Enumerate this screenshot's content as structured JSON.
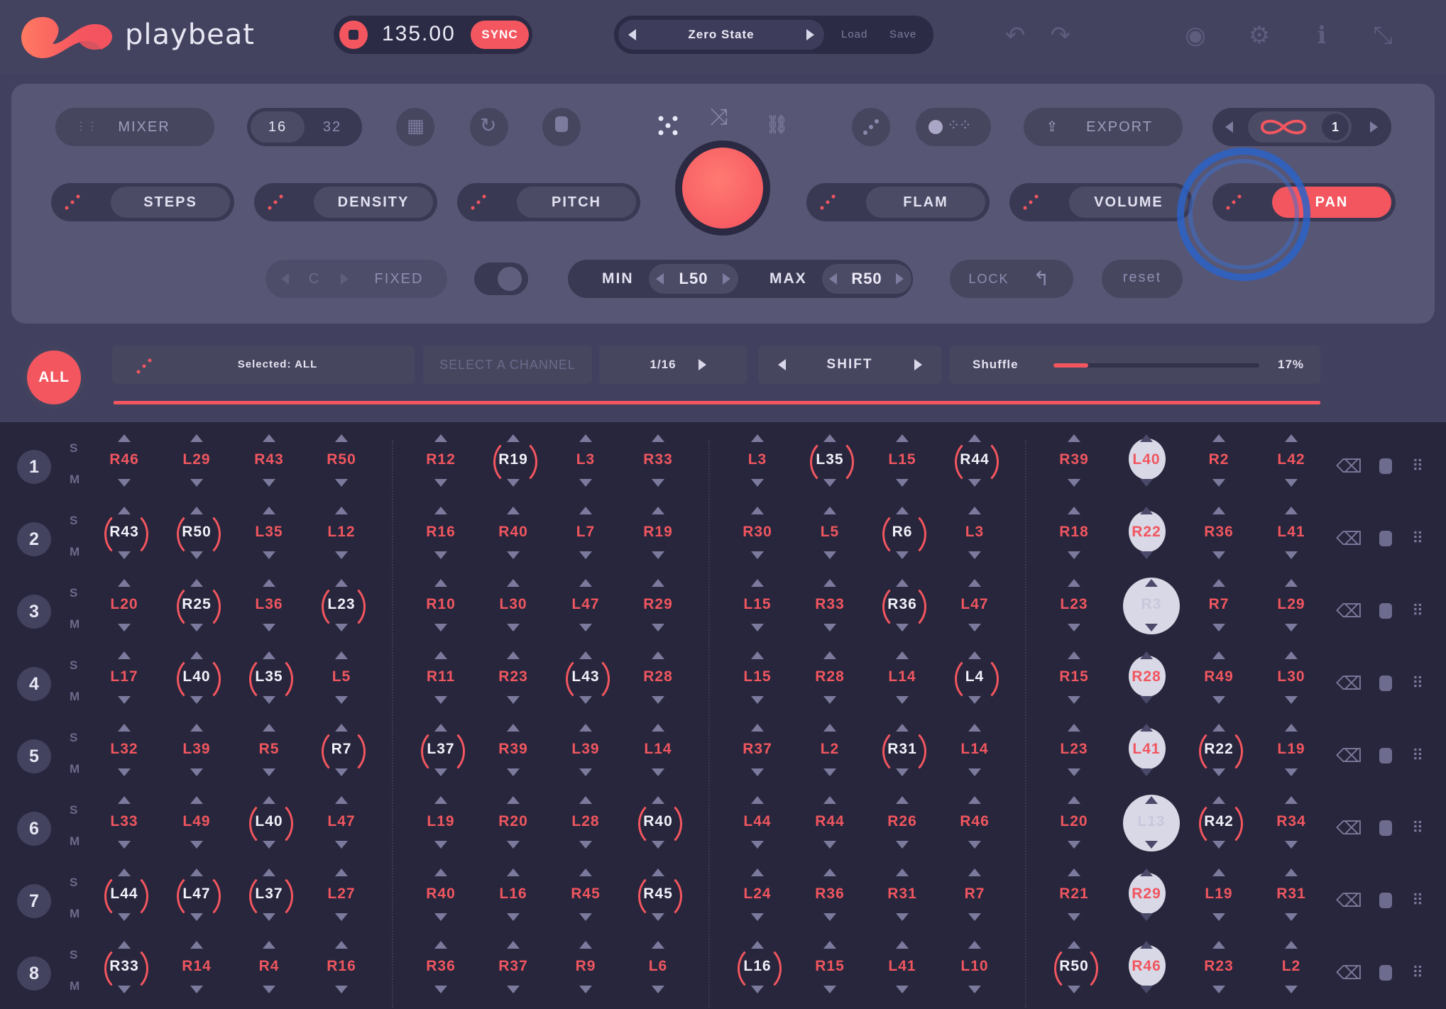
{
  "app": {
    "name": "playbeat"
  },
  "transport": {
    "bpm": "135.00",
    "sync_label": "SYNC"
  },
  "preset": {
    "name": "Zero State",
    "load_label": "Load",
    "save_label": "Save"
  },
  "header_icons": [
    "undo-icon",
    "redo-icon",
    "palette-icon",
    "gear-icon",
    "info-icon",
    "collapse-icon"
  ],
  "panel": {
    "mixer_label": "MIXER",
    "steps_options": [
      "16",
      "32"
    ],
    "export_label": "EXPORT",
    "pattern_number": "1",
    "params": [
      "STEPS",
      "DENSITY",
      "PITCH",
      "FLAM",
      "VOLUME",
      "PAN"
    ],
    "active_param": "PAN",
    "key_value": "C",
    "key_mode": "FIXED",
    "min_label": "MIN",
    "min_value": "L50",
    "max_label": "MAX",
    "max_value": "R50",
    "lock_label": "LOCK",
    "reset_label": "reset"
  },
  "selection": {
    "all_label": "ALL",
    "selected_text": "Selected: ALL",
    "select_channel_placeholder": "SELECT A CHANNEL",
    "resolution": "1/16",
    "shift_label": "SHIFT",
    "shuffle_label": "Shuffle",
    "shuffle_value": "17%",
    "shuffle_fraction": 0.17
  },
  "channels": [
    {
      "num": "1",
      "s": "S",
      "m": "M",
      "steps": [
        "R46",
        "L29",
        "R43",
        "R50",
        "R12",
        "R19",
        "L3",
        "R33",
        "L3",
        "L35",
        "L15",
        "R44",
        "R39",
        "L40",
        "R2",
        "L42"
      ]
    },
    {
      "num": "2",
      "s": "S",
      "m": "M",
      "steps": [
        "R43",
        "R50",
        "L35",
        "L12",
        "R16",
        "R40",
        "L7",
        "R19",
        "R30",
        "L5",
        "R6",
        "L3",
        "R18",
        "R22",
        "R36",
        "L41"
      ]
    },
    {
      "num": "3",
      "s": "S",
      "m": "M",
      "steps": [
        "L20",
        "R25",
        "L36",
        "L23",
        "R10",
        "L30",
        "L47",
        "R29",
        "L15",
        "R33",
        "R36",
        "L47",
        "L23",
        "R3",
        "R7",
        "L29"
      ]
    },
    {
      "num": "4",
      "s": "S",
      "m": "M",
      "steps": [
        "L17",
        "L40",
        "L35",
        "L5",
        "R11",
        "R23",
        "L43",
        "R28",
        "L15",
        "R28",
        "L14",
        "L4",
        "R15",
        "R28",
        "R49",
        "L30"
      ]
    },
    {
      "num": "5",
      "s": "S",
      "m": "M",
      "steps": [
        "L32",
        "L39",
        "R5",
        "R7",
        "L37",
        "R39",
        "L39",
        "L14",
        "R37",
        "L2",
        "R31",
        "L14",
        "L23",
        "L41",
        "R22",
        "L19"
      ]
    },
    {
      "num": "6",
      "s": "S",
      "m": "M",
      "steps": [
        "L33",
        "L49",
        "L40",
        "L47",
        "L19",
        "R20",
        "L28",
        "R40",
        "L44",
        "R44",
        "R26",
        "R46",
        "L20",
        "L13",
        "R42",
        "R34"
      ]
    },
    {
      "num": "7",
      "s": "S",
      "m": "M",
      "steps": [
        "L44",
        "L47",
        "L37",
        "L27",
        "R40",
        "L16",
        "R45",
        "R45",
        "L24",
        "R36",
        "R31",
        "R7",
        "R21",
        "R29",
        "L19",
        "R31"
      ]
    },
    {
      "num": "8",
      "s": "S",
      "m": "M",
      "steps": [
        "R33",
        "R14",
        "R4",
        "R16",
        "R36",
        "R37",
        "R9",
        "L6",
        "L16",
        "R15",
        "L41",
        "L10",
        "R50",
        "R46",
        "R23",
        "L2"
      ]
    }
  ]
}
